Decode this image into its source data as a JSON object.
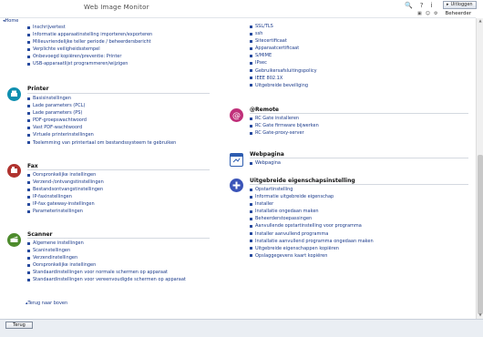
{
  "app": {
    "title": "Web Image Monitor"
  },
  "header": {
    "logout_label": "Uitloggen",
    "admin_label": "Beheerder",
    "icons": [
      "search-icon",
      "help-icon",
      "info-icon",
      "logout-icon"
    ]
  },
  "nav": {
    "home_label": "Home"
  },
  "left_top": {
    "items": [
      "Inschrijvertest",
      "Informatie apparaatinstelling importeren/exporteren",
      "Milieuvriendelijke teller periode / beheerdersbericht",
      "Verplichte veiligheidsstempel",
      "Onbevoegd kopiëren/preventie: Printer",
      "USB-apparaatlijst programmeren/wijzigen"
    ]
  },
  "printer": {
    "title": "Printer",
    "items": [
      "Basisinstellingen",
      "Lade parameters (PCL)",
      "Lade parameters (PS)",
      "PDF-groepswachtwoord",
      "Vast PDF-wachtwoord",
      "Virtuele printerinstellingen",
      "Toelemming van printertaal om bestandssysteem te gebruiken"
    ]
  },
  "fax": {
    "title": "Fax",
    "items": [
      "Oorspronkelijke instellingen",
      "Verzend-/ontvangstinstellingen",
      "Bestandsontvangstinstellingen",
      "IP-faxinstellingen",
      "IP-fax gateway-instellingen",
      "Parameterinstellingen"
    ]
  },
  "scanner": {
    "title": "Scanner",
    "items": [
      "Algemene instellingen",
      "Scaninstellingen",
      "Verzendinstellingen",
      "Oorspronkelijke instellingen",
      "Standaardinstellingen voor normale schermen op apparaat",
      "Standaardinstellingen voor vereenvoudigde schermen op apparaat"
    ]
  },
  "back_to_top": "Terug naar boven",
  "right_top": {
    "items": [
      "SSL/TLS",
      "ssh",
      "Sitecertificaat",
      "Apparaatcertificaat",
      "S/MIME",
      "IPsec",
      "Gebruikersafsluitingspolicy",
      "IEEE 802.1X",
      "Uitgebreide beveiliging"
    ]
  },
  "remote": {
    "title": "@Remote",
    "items": [
      "RC Gate installeren",
      "RC Gate firmware bijwerken",
      "RC Gate-proxy-server"
    ]
  },
  "webpage": {
    "title": "Webpagina",
    "items": [
      "Webpagina"
    ]
  },
  "extended": {
    "title": "Uitgebreide eigenschapsinstelling",
    "items": [
      "Opstartinstelling",
      "Informatie uitgebreide eigenschap",
      "Installer",
      "Installatie ongedaan maken",
      "Beheerderstoepassingen",
      "Aanvullende opstartinstelling voor programma",
      "Installer aanvullend programma",
      "Installatie aanvullend programma ongedaan maken",
      "Uitgebreide eigenschappen kopiëren",
      "Opslaggegevens kaart kopiëren"
    ]
  },
  "footer": {
    "back_button": "Terug"
  },
  "colors": {
    "link": "#1a3a8a",
    "bullet": "#274a9e",
    "printer_icon": "#0f8fb0",
    "fax_icon": "#b0332f",
    "scanner_icon": "#4d8b2c",
    "remote_icon": "#c0307a",
    "webpage_icon": "#2e5db0",
    "extended_icon": "#3b54b8"
  }
}
